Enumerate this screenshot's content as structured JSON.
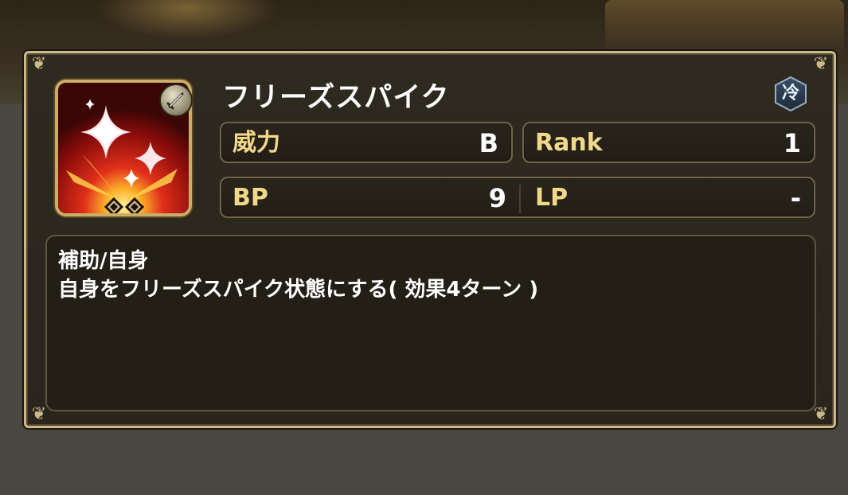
{
  "skill": {
    "name": "フリーズスパイク",
    "element": "冷",
    "weapon_icon": "sword-icon"
  },
  "stats": {
    "power": {
      "label": "威力",
      "value": "B"
    },
    "rank": {
      "label": "Rank",
      "value": "1"
    },
    "bp": {
      "label": "BP",
      "value": "9"
    },
    "lp": {
      "label": "LP",
      "value": "-"
    }
  },
  "description": {
    "target": "補助/自身",
    "effect": "自身をフリーズスパイク状態にする( 効果4ターン )"
  },
  "colors": {
    "frame": "#cbb98a",
    "label_gold": "#f2d98a",
    "icon_red": "#b3140e"
  }
}
